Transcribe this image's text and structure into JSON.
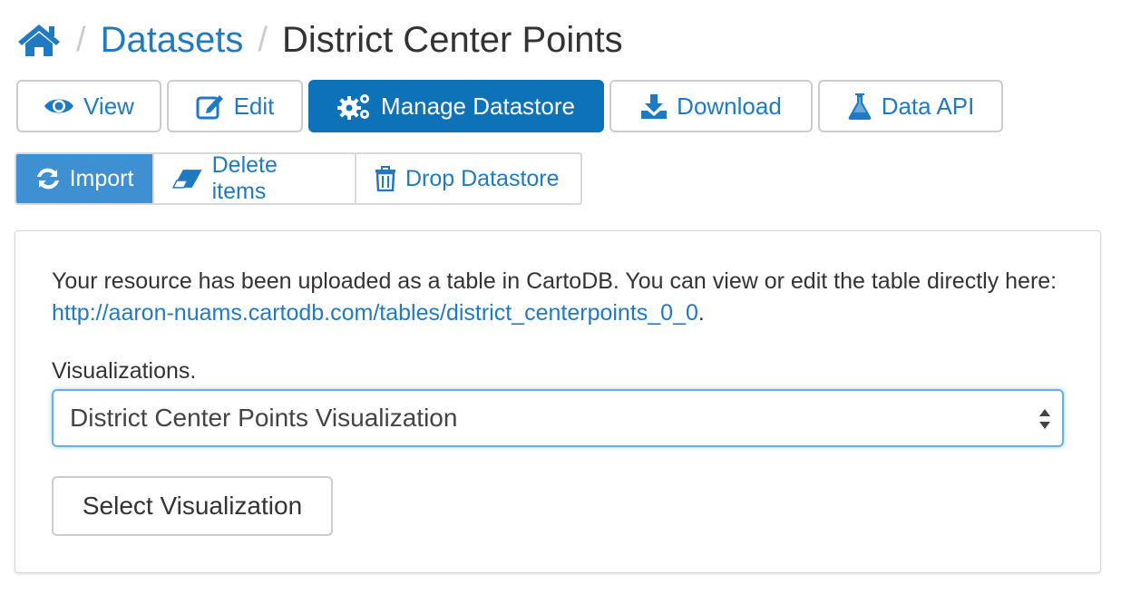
{
  "breadcrumb": {
    "home_icon": "home-icon",
    "separator": "/",
    "datasets": "Datasets",
    "current": "District Center Points"
  },
  "toolbar": {
    "view": "View",
    "edit": "Edit",
    "manage": "Manage Datastore",
    "download": "Download",
    "data_api": "Data API"
  },
  "subnav": {
    "import": "Import",
    "delete_items": "Delete items",
    "drop_datastore": "Drop Datastore"
  },
  "panel": {
    "message_text": "Your resource has been uploaded as a table in CartoDB. You can view or edit the table directly here: ",
    "message_link": "http://aaron-nuams.cartodb.com/tables/district_centerpoints_0_0",
    "message_end": ".",
    "viz_label": "Visualizations.",
    "selected_viz": "District Center Points Visualization",
    "select_button": "Select Visualization"
  },
  "colors": {
    "link": "#1f7ac3",
    "primary": "#0e72b9",
    "active_tab": "#3f8fd3",
    "focus_border": "#66afe9"
  }
}
